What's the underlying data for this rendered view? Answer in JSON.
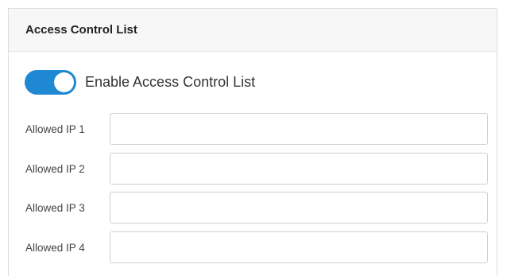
{
  "panel": {
    "title": "Access Control List"
  },
  "toggle": {
    "label": "Enable Access Control List",
    "enabled": true,
    "color": "#1e88d3"
  },
  "fields": [
    {
      "label": "Allowed IP 1",
      "value": "",
      "placeholder": ""
    },
    {
      "label": "Allowed IP 2",
      "value": "",
      "placeholder": ""
    },
    {
      "label": "Allowed IP 3",
      "value": "",
      "placeholder": ""
    },
    {
      "label": "Allowed IP 4",
      "value": "",
      "placeholder": ""
    }
  ]
}
